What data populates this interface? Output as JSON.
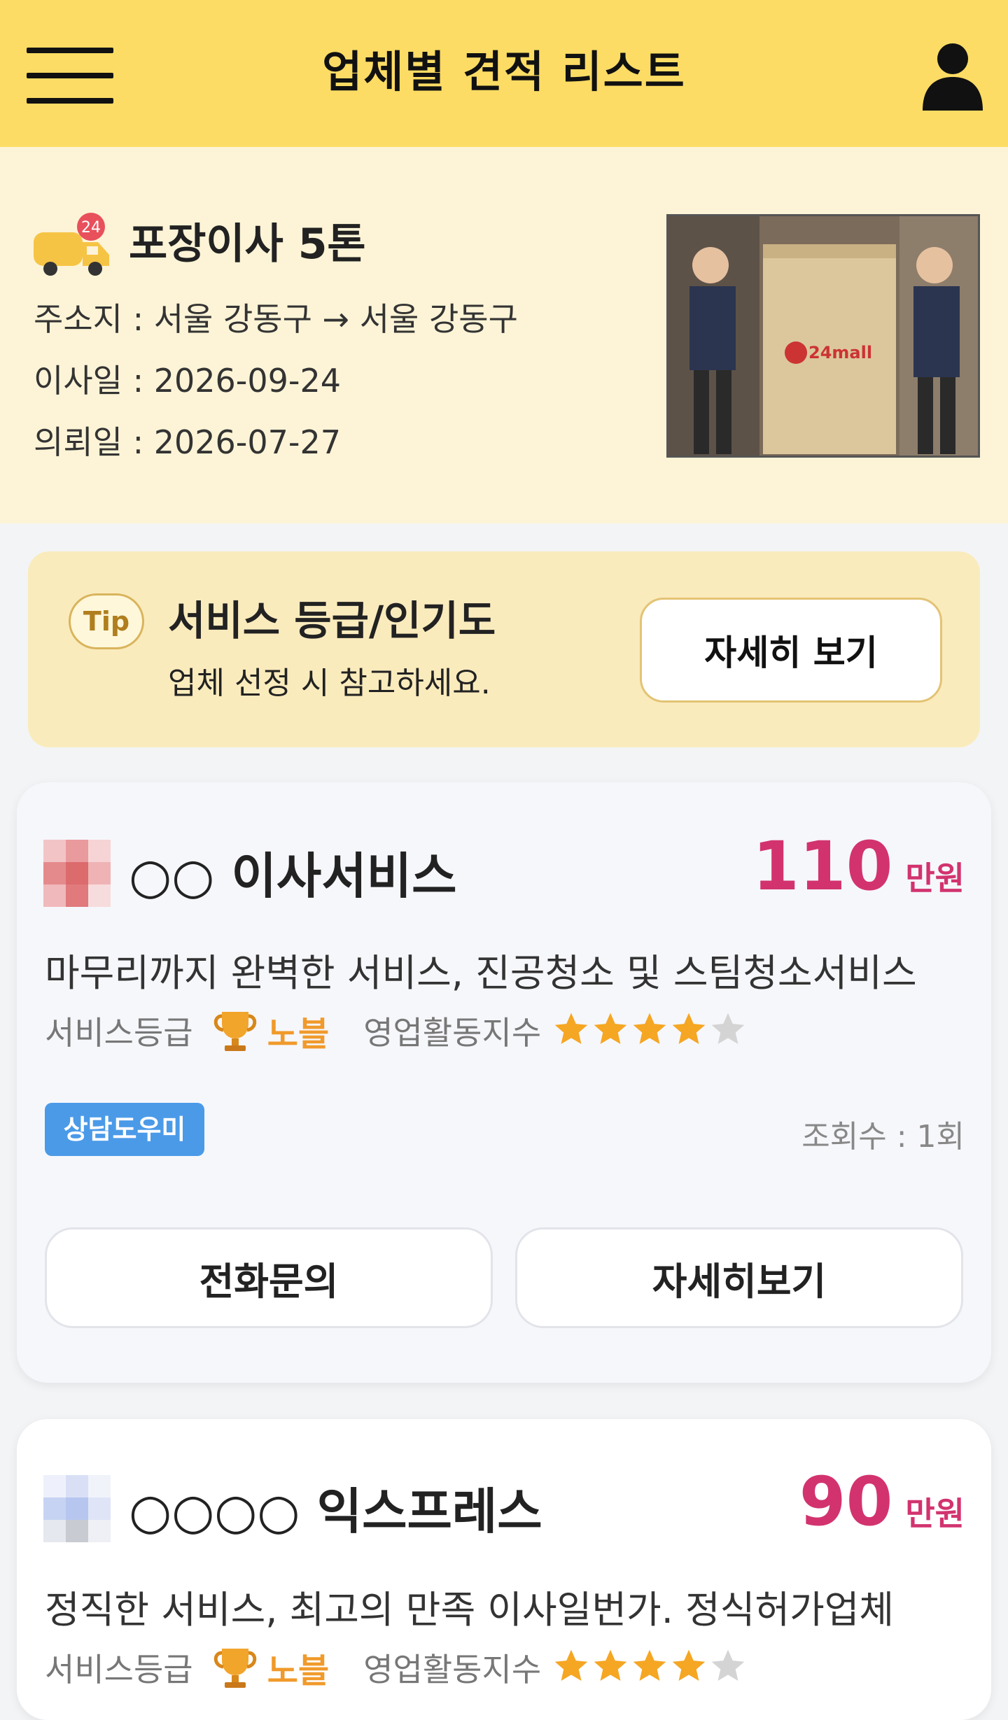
{
  "header": {
    "title": "업체별 견적 리스트",
    "menu_icon": "hamburger-menu-icon",
    "user_icon": "user-icon"
  },
  "request": {
    "badge": "24",
    "title": "포장이사 5톤",
    "route": "주소지 : 서울 강동구 → 서울 강동구",
    "move_date": "이사일 : 2026-09-24",
    "request_date": "의뢰일 : 2026-07-27",
    "photo_text": "24mall"
  },
  "tip": {
    "badge": "Tip",
    "title": "서비스 등급/인기도",
    "subtitle": "업체 선정 시 참고하세요.",
    "button": "자세히 보기"
  },
  "companies": [
    {
      "name": "○○ 이사서비스",
      "price": "110",
      "unit": "만원",
      "description": "마무리까지 완벽한 서비스, 진공청소 및 스팀청소서비스",
      "service_grade_label": "서비스등급",
      "service_grade": "노블",
      "activity_label": "영업활동지수",
      "activity_stars": 4,
      "activity_max": 5,
      "tag": "상담도우미",
      "views": "조회수 : 1회",
      "call_button": "전화문의",
      "detail_button": "자세히보기"
    },
    {
      "name": "○○○○ 익스프레스",
      "price": "90",
      "unit": "만원",
      "description": "정직한 서비스, 최고의 만족 이사일번가. 정식허가업체",
      "service_grade_label": "서비스등급",
      "service_grade": "노블",
      "activity_label": "영업활동지수",
      "activity_stars": 4,
      "activity_max": 5
    }
  ],
  "colors": {
    "header_bg": "#fcdc64",
    "summary_bg": "#fdf4d7",
    "tip_bg": "#faebbd",
    "price": "#d2336f",
    "grade": "#f09a2b",
    "tag": "#4b9ae8"
  }
}
